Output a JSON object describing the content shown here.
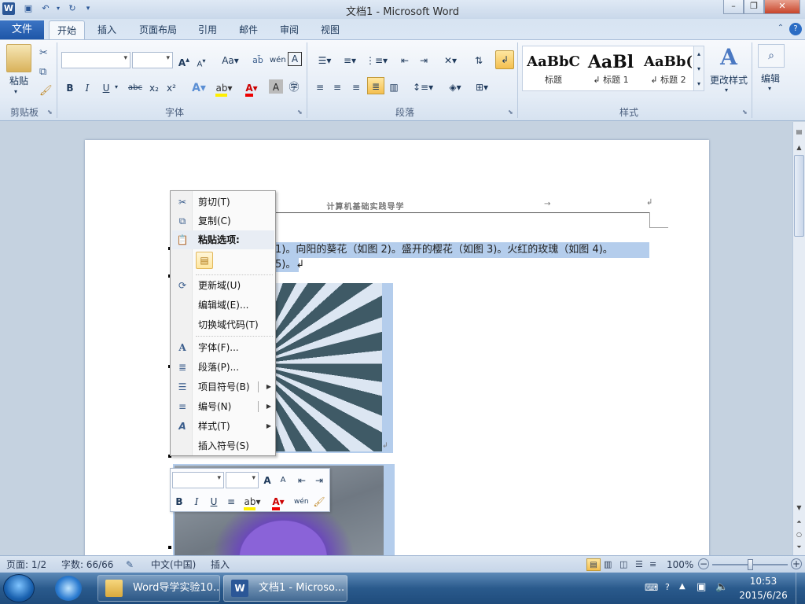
{
  "window": {
    "title": "文档1 - Microsoft Word"
  },
  "quick_access": {
    "save_icon": "save-icon",
    "undo_icon": "undo-icon",
    "redo_icon": "redo-icon"
  },
  "tabs": [
    {
      "label": "文件"
    },
    {
      "label": "开始"
    },
    {
      "label": "插入"
    },
    {
      "label": "页面布局"
    },
    {
      "label": "引用"
    },
    {
      "label": "邮件"
    },
    {
      "label": "审阅"
    },
    {
      "label": "视图"
    }
  ],
  "ribbon": {
    "clipboard": {
      "paste_label": "粘贴",
      "group_label": "剪贴板"
    },
    "font": {
      "group_label": "字体",
      "grow": "A",
      "shrink": "A",
      "case": "Aa",
      "clear": "A",
      "bold": "B",
      "italic": "I",
      "underline": "U",
      "strike": "abc",
      "sub": "x₂",
      "sup": "x²"
    },
    "paragraph": {
      "group_label": "段落"
    },
    "styles": {
      "group_label": "样式",
      "items": [
        {
          "preview": "AaBbC",
          "name": "标题"
        },
        {
          "preview": "AaBl",
          "name": "↲ 标题 1"
        },
        {
          "preview": "AaBb(",
          "name": "↲ 标题 2"
        }
      ],
      "change_label": "更改样式"
    },
    "editing": {
      "label": "编辑"
    }
  },
  "document": {
    "header_text": "计算机基础实践导学",
    "line1": "1)。向阳的葵花（如图 2)。盛开的樱花（如图 3)。火红的玫瑰（如图 4)。",
    "line2": "5)。↲"
  },
  "context_menu": {
    "items": [
      {
        "label": "剪切(T)",
        "icon": "scissors-icon"
      },
      {
        "label": "复制(C)",
        "icon": "copy-icon"
      },
      {
        "label": "粘贴选项:",
        "icon": "paste-icon"
      },
      {
        "label": "更新域(U)",
        "icon": "update-field-icon"
      },
      {
        "label": "编辑域(E)...",
        "icon": ""
      },
      {
        "label": "切换域代码(T)",
        "icon": ""
      },
      {
        "label": "字体(F)...",
        "icon": "font-icon"
      },
      {
        "label": "段落(P)...",
        "icon": "paragraph-icon"
      },
      {
        "label": "项目符号(B)",
        "icon": "bullets-icon"
      },
      {
        "label": "编号(N)",
        "icon": "numbering-icon"
      },
      {
        "label": "样式(T)",
        "icon": "styles-icon"
      },
      {
        "label": "插入符号(S)",
        "icon": ""
      }
    ]
  },
  "mini_toolbar": {
    "bold": "B",
    "italic": "I",
    "underline": "U",
    "grow": "A",
    "shrink": "A"
  },
  "status": {
    "page": "页面: 1/2",
    "words": "字数: 66/66",
    "language": "中文(中国)",
    "mode": "插入",
    "zoom": "100%",
    "zoom_level": 100
  },
  "taskbar": {
    "items": [
      {
        "label": "Word导学实验10..."
      },
      {
        "label": "文档1 - Microso..."
      }
    ],
    "time": "10:53",
    "date": "2015/6/26"
  },
  "colors": {
    "file_tab": "#2b5797",
    "selection": "#b4cdec",
    "accent": "#1e395b"
  }
}
